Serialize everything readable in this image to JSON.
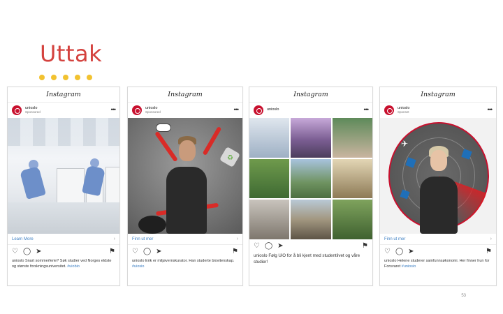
{
  "slide": {
    "title": "Uttak",
    "page_number": "53",
    "accent_color": "#d4423e",
    "dot_color": "#f2c230",
    "dot_count": 5
  },
  "posts": [
    {
      "platform": "Instagram",
      "account": "unioslo",
      "account_sub": "Sponsored",
      "cta": "Learn More",
      "caption": "unioslo Snart sommerferie? Søk studier ved Norges eldste og største forskningsuniversitet.",
      "hashtag": "#uiobio"
    },
    {
      "platform": "Instagram",
      "account": "unioslo",
      "account_sub": "Sponsored",
      "cta": "Finn ut mer",
      "caption": "unioslo Erik er miljøvernskurator. Han studerte biovitenskap.",
      "hashtag": "#uiosio"
    },
    {
      "platform": "Instagram",
      "account": "unioslo",
      "account_sub": "",
      "cta": "",
      "caption": "unioslo Følg UiO for å bli kjent med studentlivet og våre studier!",
      "hashtag": ""
    },
    {
      "platform": "Instagram",
      "account": "unioslo",
      "account_sub": "Sponset",
      "cta": "Finn ut mer",
      "caption": "unioslo Helene studerer samfunnsøkonomi. Her finner hun for Forsvaret",
      "hashtag": "#uniosio"
    }
  ]
}
